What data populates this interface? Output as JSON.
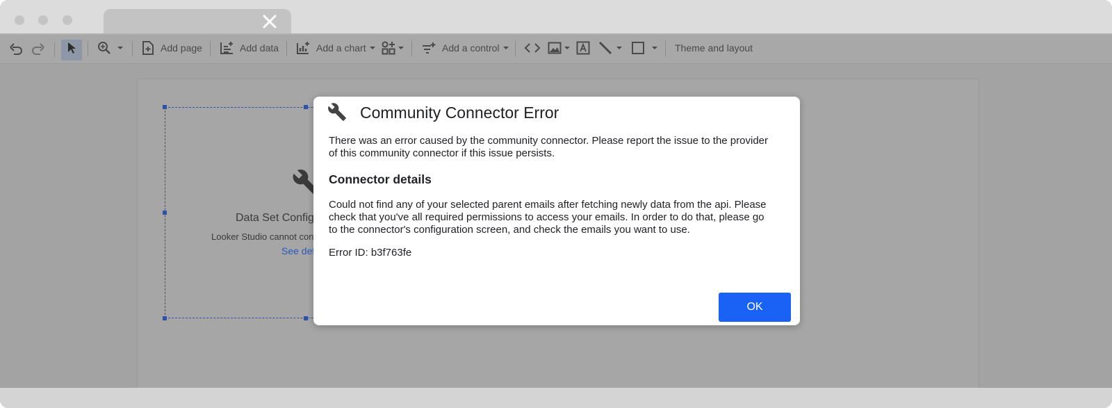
{
  "browser": {
    "tab_close": "close-icon"
  },
  "toolbar": {
    "add_page": "Add page",
    "add_data": "Add data",
    "add_chart": "Add a chart",
    "add_control": "Add a control",
    "theme_layout": "Theme and layout"
  },
  "canvas": {
    "component_title": "Data Set Config",
    "component_desc": "Looker Studio cannot con",
    "component_link": "See det"
  },
  "dialog": {
    "title": "Community Connector Error",
    "intro_line1": "There was an error caused by the community connector. Please report the issue to the provider",
    "intro_line2": "of this community connector if this issue persists.",
    "details_heading": "Connector details",
    "details_line1": "Could not find any of your selected parent emails after fetching newly data from the api. Please",
    "details_line2": "check that you've all required permissions to access your emails. In order to do that, please go",
    "details_line3": "to the connector's configuration screen, and check the emails you want to use.",
    "error_id": "Error ID: b3f763fe",
    "ok_label": "OK"
  },
  "colors": {
    "accent": "#1a62f5",
    "selection": "#2b53a8"
  }
}
